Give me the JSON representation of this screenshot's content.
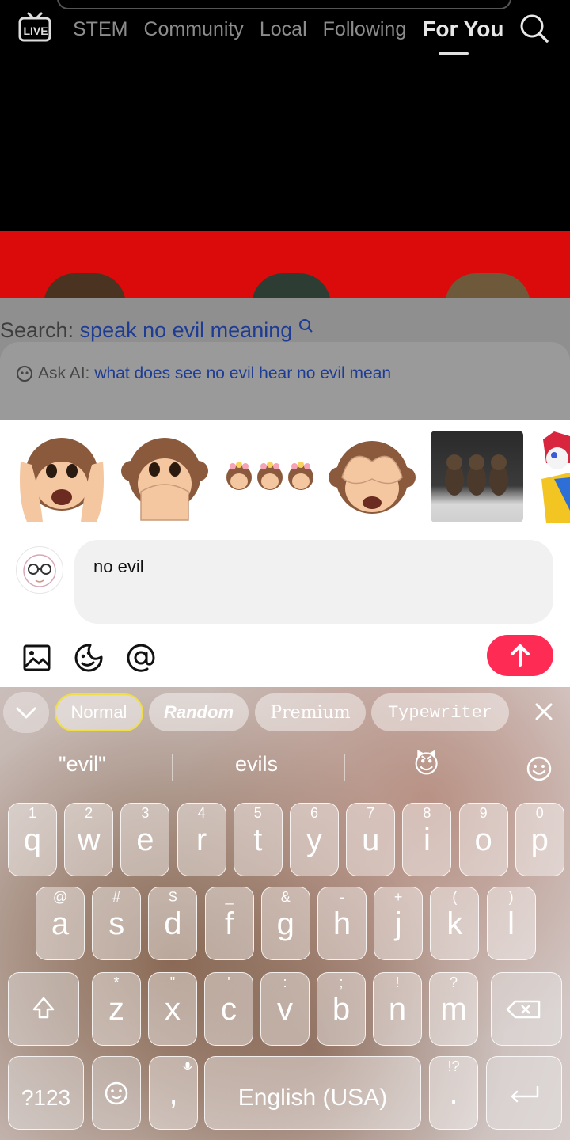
{
  "topnav": {
    "live_label": "LIVE",
    "tabs": [
      "STEM",
      "Community",
      "Local",
      "Following",
      "For You"
    ],
    "active_tab": "For You"
  },
  "search_overlay": {
    "prefix": "Search:",
    "query": "speak no evil meaning",
    "ask_ai_label": "Ask AI:",
    "ask_ai_query": "what does see no evil hear no evil mean"
  },
  "stickers": [
    "hear-no-evil-monkey",
    "speak-no-evil-monkey",
    "three-monkeys-flower-crowns",
    "see-no-evil-monkey",
    "three-monkeys-photo",
    "jester-character"
  ],
  "comment": {
    "value": "no evil",
    "tools": [
      "image-icon",
      "sticker-icon",
      "mention-icon"
    ],
    "send_icon": "arrow-up-icon"
  },
  "keyboard": {
    "font_styles": [
      "Normal",
      "Random",
      "Premium",
      "Typewriter"
    ],
    "active_style": "Normal",
    "suggestions": [
      "\"evil\"",
      "evils",
      "😈"
    ],
    "rows": [
      [
        {
          "k": "q",
          "s": "1"
        },
        {
          "k": "w",
          "s": "2"
        },
        {
          "k": "e",
          "s": "3"
        },
        {
          "k": "r",
          "s": "4"
        },
        {
          "k": "t",
          "s": "5"
        },
        {
          "k": "y",
          "s": "6"
        },
        {
          "k": "u",
          "s": "7"
        },
        {
          "k": "i",
          "s": "8"
        },
        {
          "k": "o",
          "s": "9"
        },
        {
          "k": "p",
          "s": "0"
        }
      ],
      [
        {
          "k": "a",
          "s": "@"
        },
        {
          "k": "s",
          "s": "#"
        },
        {
          "k": "d",
          "s": "$"
        },
        {
          "k": "f",
          "s": "_"
        },
        {
          "k": "g",
          "s": "&"
        },
        {
          "k": "h",
          "s": "-"
        },
        {
          "k": "j",
          "s": "+"
        },
        {
          "k": "k",
          "s": "("
        },
        {
          "k": "l",
          "s": ")"
        }
      ],
      [
        {
          "k": "z",
          "s": "*"
        },
        {
          "k": "x",
          "s": "\""
        },
        {
          "k": "c",
          "s": "'"
        },
        {
          "k": "v",
          "s": ":"
        },
        {
          "k": "b",
          "s": ";"
        },
        {
          "k": "n",
          "s": "!"
        },
        {
          "k": "m",
          "s": "?"
        }
      ]
    ],
    "symbols_key": "?123",
    "comma_key": ",",
    "space_label": "English (USA)",
    "period_key": ".",
    "period_sub": "!?"
  },
  "colors": {
    "send": "#fe2c55",
    "query_blue": "#1e3c93",
    "active_chip_border": "#f0de49"
  }
}
